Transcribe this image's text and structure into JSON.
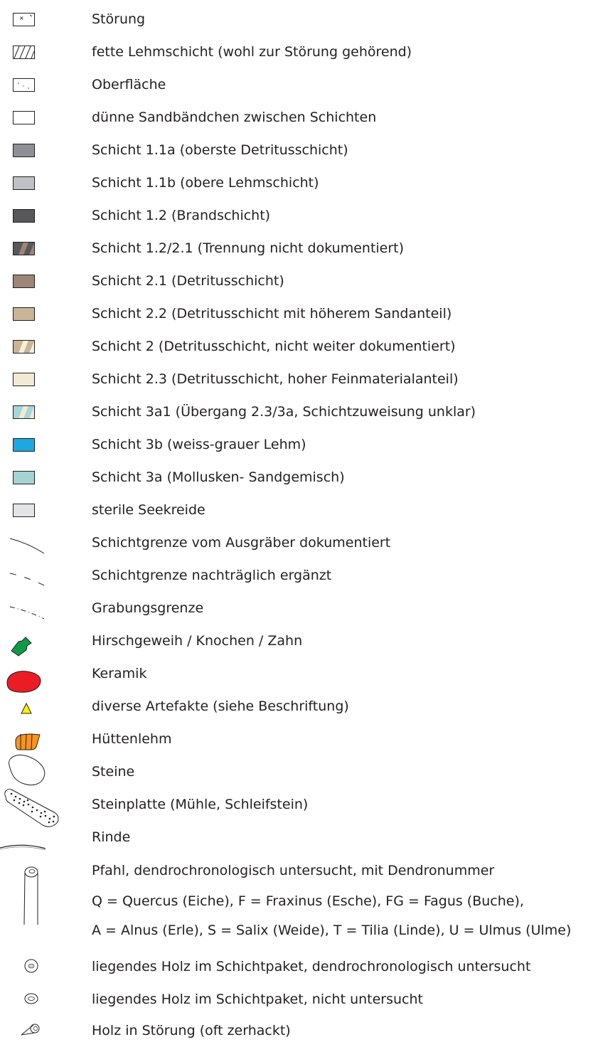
{
  "legend": {
    "items": [
      {
        "id": "stoerung",
        "label": "Störung",
        "icon": "stoerung-symbol-icon"
      },
      {
        "id": "fette-lehm",
        "label": "fette Lehmschicht (wohl zur Störung gehörend)",
        "icon": "hatched-square-icon"
      },
      {
        "id": "oberflaeche",
        "label": "Oberfläche",
        "icon": "dotted-square-icon"
      },
      {
        "id": "sandbaendchen",
        "label": "dünne Sandbändchen zwischen Schichten",
        "icon": "empty-square-icon",
        "color": "#ffffff"
      },
      {
        "id": "s11a",
        "label": "Schicht 1.1a (oberste Detritusschicht)",
        "icon": "swatch-icon",
        "color": "#8e9095"
      },
      {
        "id": "s11b",
        "label": "Schicht 1.1b (obere Lehmschicht)",
        "icon": "swatch-icon",
        "color": "#c0c1c6"
      },
      {
        "id": "s12",
        "label": "Schicht 1.2 (Brandschicht)",
        "icon": "swatch-icon",
        "color": "#58585b"
      },
      {
        "id": "s12-21",
        "label": "Schicht 1.2/2.1 (Trennung nicht dokumentiert)",
        "icon": "striped-swatch-icon",
        "color": "#58585b",
        "color2": "#9d8577"
      },
      {
        "id": "s21",
        "label": "Schicht 2.1 (Detritusschicht)",
        "icon": "swatch-icon",
        "color": "#9d8577"
      },
      {
        "id": "s22",
        "label": "Schicht 2.2 (Detritusschicht mit höherem Sandanteil)",
        "icon": "swatch-icon",
        "color": "#c7b595"
      },
      {
        "id": "s2",
        "label": "Schicht 2 (Detritusschicht, nicht weiter dokumentiert)",
        "icon": "striped-swatch-icon",
        "color": "#c7b595",
        "color2": "#f5efdf"
      },
      {
        "id": "s23",
        "label": "Schicht 2.3 (Detritusschicht, hoher Feinmaterialanteil)",
        "icon": "swatch-icon",
        "color": "#f2ead5"
      },
      {
        "id": "s3a1",
        "label": "Schicht 3a1 (Übergang 2.3/3a, Schichtzuweisung unklar)",
        "icon": "striped-swatch-icon",
        "color": "#a9d5d8",
        "color2": "#f2ead5"
      },
      {
        "id": "s3b",
        "label": "Schicht 3b (weiss-grauer Lehm)",
        "icon": "swatch-icon",
        "color": "#1ea8e0"
      },
      {
        "id": "s3a",
        "label": "Schicht 3a (Mollusken- Sandgemisch)",
        "icon": "swatch-icon",
        "color": "#a5d2d3"
      },
      {
        "id": "seekreide",
        "label": "sterile Seekreide",
        "icon": "swatch-icon",
        "color": "#e3e4e5"
      },
      {
        "id": "grenze-dok",
        "label": "Schichtgrenze vom Ausgräber dokumentiert",
        "icon": "solid-line-icon"
      },
      {
        "id": "grenze-ergaenzt",
        "label": "Schichtgrenze nachträglich ergänzt",
        "icon": "dashed-line-icon"
      },
      {
        "id": "grabungsgrenze",
        "label": "Grabungsgrenze",
        "icon": "dash-dot-line-icon"
      },
      {
        "id": "hirschgeweih",
        "label": "Hirschgeweih / Knochen / Zahn",
        "icon": "bone-icon",
        "color": "#0e9a48"
      },
      {
        "id": "keramik",
        "label": "Keramik",
        "icon": "ceramic-icon",
        "color": "#ec1c24"
      },
      {
        "id": "artefakte",
        "label": "diverse Artefakte (siehe Beschriftung)",
        "icon": "triangle-icon",
        "color": "#fff200"
      },
      {
        "id": "huettenlehm",
        "label": "Hüttenlehm",
        "icon": "daub-icon",
        "color": "#f7941d"
      },
      {
        "id": "steine",
        "label": "Steine",
        "icon": "stone-icon"
      },
      {
        "id": "steinplatte",
        "label": "Steinplatte (Mühle, Schleifstein)",
        "icon": "stone-slab-icon"
      },
      {
        "id": "rinde",
        "label": "Rinde",
        "icon": "bark-icon"
      }
    ],
    "pfahl": {
      "lines": [
        "Pfahl, dendrochronologisch untersucht, mit Dendronummer",
        "Q = Quercus (Eiche), F = Fraxinus (Esche), FG = Fagus (Buche),",
        "A = Alnus (Erle), S = Salix (Weide), T = Tilia (Linde), U = Ulmus (Ulme)"
      ],
      "icon": "post-icon"
    },
    "holz": [
      {
        "id": "holz-untersucht",
        "label": "liegendes Holz im Schichtpaket, dendrochronologisch untersucht",
        "icon": "wood-dot-icon"
      },
      {
        "id": "holz-nicht",
        "label": "liegendes Holz im Schichtpaket, nicht untersucht",
        "icon": "wood-ring-icon"
      },
      {
        "id": "holz-stoerung",
        "label": "Holz in Störung (oft zerhackt)",
        "icon": "wood-cut-icon"
      }
    ]
  }
}
